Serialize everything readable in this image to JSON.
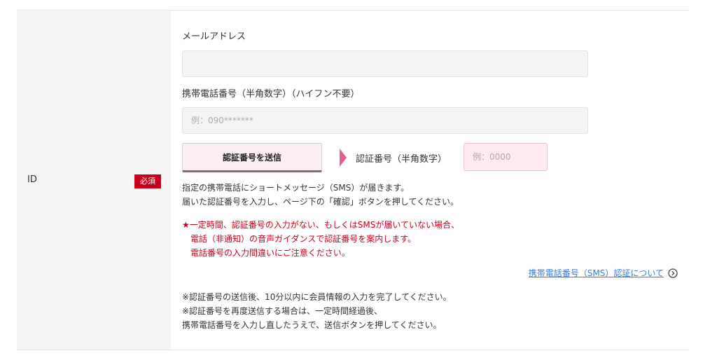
{
  "row": {
    "label": "ID",
    "required_badge": "必須"
  },
  "email": {
    "label": "メールアドレス",
    "value": "",
    "placeholder": ""
  },
  "phone": {
    "label": "携帯電話番号（半角数字）（ハイフン不要）",
    "value": "",
    "placeholder": "例：090*******"
  },
  "verify": {
    "send_button_label": "認証番号を送信",
    "code_label": "認証番号（半角数字）",
    "code_placeholder": "例：0000",
    "code_value": ""
  },
  "info": {
    "line1": "指定の携帯電話にショートメッセージ（SMS）が届きます。",
    "line2": "届いた認証番号を入力し、ページ下の「確認」ボタンを押してください。"
  },
  "warning": {
    "line1": "★一定時間、認証番号の入力がない、もしくはSMSが届いていない場合、",
    "line2": "電話（非通知）の音声ガイダンスで認証番号を案内します。",
    "line3": "電話番号の入力間違いにご注意ください。"
  },
  "help_link": {
    "label": "携帯電話番号（SMS）認証について",
    "icon": "chevron-right-circle-icon"
  },
  "notes": {
    "line1": "※認証番号の送信後、10分以内に会員情報の入力を完了してください。",
    "line2": "※認証番号を再度送信する場合は、一定時間経過後、",
    "line3": "携帯電話番号を入力し直したうえで、送信ボタンを押してください。"
  },
  "colors": {
    "required": "#c8001e",
    "warning": "#c8001e",
    "link": "#3a7bd5",
    "arrow": "#e8608a",
    "button_bg": "#fdeef1"
  }
}
